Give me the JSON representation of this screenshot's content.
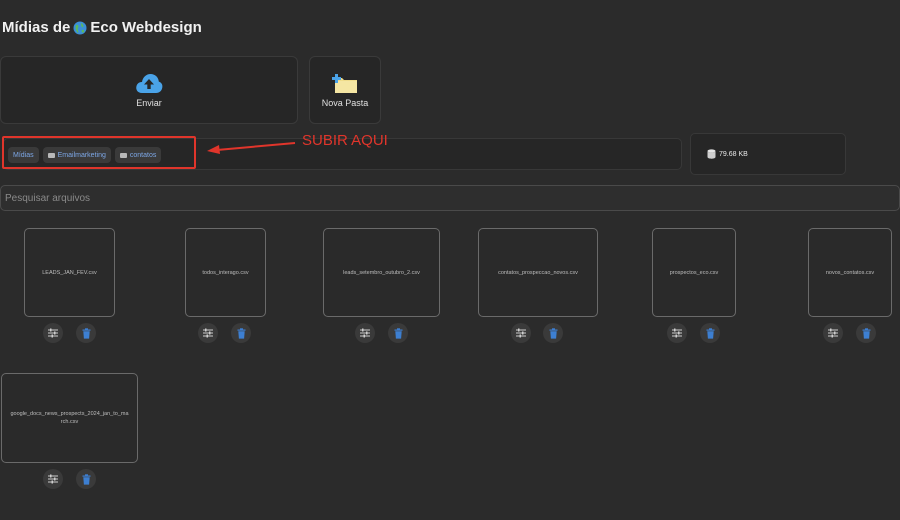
{
  "header": {
    "title_prefix": "Mídias de",
    "title_brand": "Eco Webdesign"
  },
  "actions": {
    "upload_label": "Enviar",
    "new_folder_label": "Nova Pasta"
  },
  "breadcrumb": [
    {
      "label": "Mídias"
    },
    {
      "label": "Emailmarketing"
    },
    {
      "label": "contatos"
    }
  ],
  "annotation": {
    "text": "SUBIR AQUI",
    "color": "#e0352b"
  },
  "storage": {
    "used": "79.68 KB"
  },
  "search": {
    "placeholder": "Pesquisar arquivos"
  },
  "files": [
    {
      "name": "LEADS_JAN_FEV.csv"
    },
    {
      "name": "todos_interago.csv"
    },
    {
      "name": "leads_setembro_outubro_2.csv"
    },
    {
      "name": "contatos_prospeccao_novos.csv"
    },
    {
      "name": "prospectos_eco.csv"
    },
    {
      "name": "novos_contatos.csv"
    },
    {
      "name": "google_docs_news_prospects_2024_jan_to_march.csv"
    }
  ],
  "colors": {
    "upload_icon": "#4aa3e8",
    "delete_icon": "#3d7fd1",
    "folder": "#f0dc8a"
  }
}
